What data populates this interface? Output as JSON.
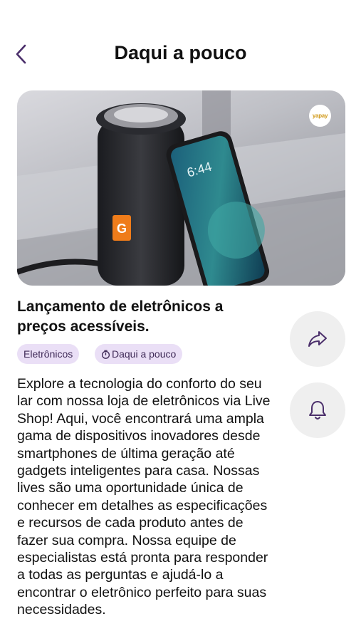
{
  "header": {
    "title": "Daqui a pouco"
  },
  "hero": {
    "badge_text": "yapay"
  },
  "event": {
    "title": "Lançamento de eletrônicos a preços acessíveis.",
    "category_chip": "Eletrônicos",
    "time_chip": "Daqui a pouco",
    "description": "Explore a tecnologia do conforto do seu lar com nossa loja de eletrônicos via Live Shop! Aqui, você encontrará uma ampla gama de dispositivos inovadores desde smartphones de última geração até gadgets inteligentes para casa. Nossas lives são uma oportunidade única de conhecer em detalhes as especificações e recursos de cada produto antes de fazer sua compra. Nossa equipe de especialistas está pronta para responder a todas as perguntas e ajudá-lo a encontrar o eletrônico perfeito para suas necessidades."
  },
  "icons": {
    "back": "chevron-left-icon",
    "share": "share-arrow-icon",
    "notify": "bell-icon",
    "time": "stopwatch-icon"
  },
  "colors": {
    "accent": "#4b2f6b",
    "chip_bg": "#eadff6",
    "action_bg": "#efefef"
  }
}
